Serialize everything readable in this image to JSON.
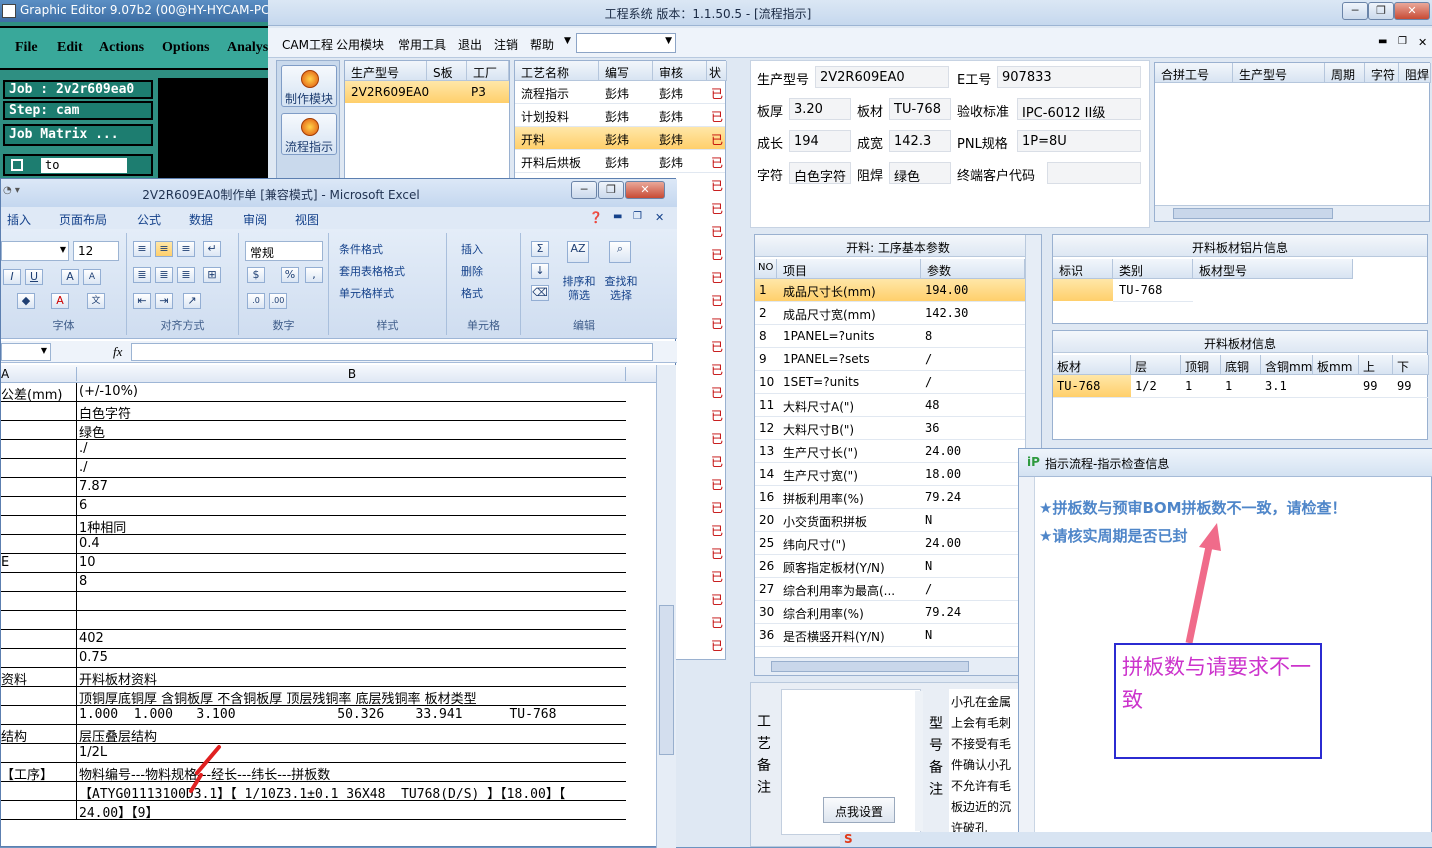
{
  "graphic_editor": {
    "title": "Graphic Editor 9.07b2 (00@HY-HYCAM-PC",
    "menu": [
      "File",
      "Edit",
      "Actions",
      "Options",
      "Analys"
    ],
    "job": "Job : 2v2r609ea0",
    "step": "Step: cam",
    "job_matrix": "Job Matrix ...",
    "to": "to"
  },
  "main": {
    "title": "工程系统   版本：1.1.50.5 - [流程指示]",
    "menu": [
      "CAM工程",
      "公用模块",
      "常用工具",
      "退出",
      "注销",
      "帮助"
    ],
    "side_buttons": [
      "制作模块",
      "流程指示"
    ],
    "model_grid": {
      "headers": [
        "生产型号",
        "S板",
        "工厂"
      ],
      "rows": [
        [
          "2V2R609EA0",
          "",
          "P3"
        ]
      ]
    },
    "process_grid": {
      "headers": [
        "工艺名称",
        "编写",
        "审核",
        "状"
      ],
      "rows": [
        [
          "流程指示",
          "彭炜",
          "彭炜",
          "已"
        ],
        [
          "计划投料",
          "彭炜",
          "彭炜",
          "已"
        ],
        [
          "开料",
          "彭炜",
          "彭炜",
          "已"
        ],
        [
          "开料后烘板",
          "彭炜",
          "彭炜",
          "已"
        ]
      ],
      "status_more": [
        "已",
        "已",
        "已",
        "已",
        "已",
        "已",
        "已",
        "已",
        "已",
        "已",
        "已",
        "已",
        "已",
        "已",
        "已",
        "已",
        "已",
        "已",
        "已",
        "已",
        "已"
      ]
    },
    "info": {
      "model_label": "生产型号",
      "model": "2V2R609EA0",
      "eno_label": "E工号",
      "eno": "907833",
      "thick_label": "板厚",
      "thick": "3.20",
      "mat_label": "板材",
      "mat": "TU-768",
      "std_label": "验收标准",
      "std": "IPC-6012 II级",
      "len_label": "成长",
      "len": "194",
      "wid_label": "成宽",
      "wid": "142.3",
      "pnl_label": "PNL规格",
      "pnl": "1P=8U",
      "char_label": "字符",
      "char": "白色字符",
      "mask_label": "阻焊",
      "mask": "绿色",
      "cust_label": "终端客户代码",
      "cust": ""
    },
    "merge_grid": {
      "headers": [
        "合拼工号",
        "生产型号",
        "周期",
        "字符",
        "阻焊"
      ]
    },
    "cut_params": {
      "title": "开料: 工序基本参数",
      "headers": [
        "NO",
        "项目",
        "参数"
      ],
      "rows": [
        [
          "1",
          "成品尺寸长(mm)",
          "194.00"
        ],
        [
          "2",
          "成品尺寸宽(mm)",
          "142.30"
        ],
        [
          "8",
          "1PANEL=?units",
          "8"
        ],
        [
          "9",
          "1PANEL=?sets",
          "/"
        ],
        [
          "10",
          "1SET=?units",
          "/"
        ],
        [
          "11",
          "大料尺寸A(\")",
          "48"
        ],
        [
          "12",
          "大料尺寸B(\")",
          "36"
        ],
        [
          "13",
          "生产尺寸长(\")",
          "24.00"
        ],
        [
          "14",
          "生产尺寸宽(\")",
          "18.00"
        ],
        [
          "16",
          "拼板利用率(%)",
          "79.24"
        ],
        [
          "20",
          "小交货面积拼板",
          "N"
        ],
        [
          "25",
          "纬向尺寸(\")",
          "24.00"
        ],
        [
          "26",
          "顾客指定板材(Y/N)",
          "N"
        ],
        [
          "27",
          "综合利用率为最高(...",
          "/"
        ],
        [
          "30",
          "综合利用率(%)",
          "79.24"
        ],
        [
          "36",
          "是否横竖开料(Y/N)",
          "N"
        ]
      ]
    },
    "al_sheet": {
      "title": "开料板材铝片信息",
      "headers": [
        "标识",
        "类别",
        "板材型号"
      ],
      "rows": [
        [
          "",
          "TU-768",
          ""
        ]
      ]
    },
    "sheet_info": {
      "title": "开料板材信息",
      "headers": [
        "板材",
        "层",
        "顶铜",
        "底铜",
        "含铜mm",
        "板mm",
        "上",
        "下"
      ],
      "rows": [
        [
          "TU-768",
          "1/2",
          "1",
          "1",
          "3.1",
          "",
          "99",
          "99"
        ]
      ]
    },
    "notes": {
      "process_label": "工艺备注",
      "model_label": "型号备注",
      "set_button": "点我设置",
      "model_notes": [
        "小孔在金属",
        "上会有毛刺",
        "不接受有毛",
        "件确认小孔",
        "不允许有毛",
        "板边近的沉",
        "许破孔"
      ]
    }
  },
  "excel": {
    "title": "2V2R609EA0制作单  [兼容模式] - Microsoft Excel",
    "tabs": [
      "插入",
      "页面布局",
      "公式",
      "数据",
      "审阅",
      "视图"
    ],
    "font_size": "12",
    "number_format": "常规",
    "groups": [
      "字体",
      "对齐方式",
      "数字",
      "样式",
      "单元格",
      "编辑"
    ],
    "style_buttons": [
      "条件格式",
      "套用表格格式",
      "单元格样式"
    ],
    "cell_buttons": [
      "插入",
      "删除",
      "格式"
    ],
    "edit_buttons": [
      "排序和筛选",
      "查找和选择"
    ],
    "fx": "fx",
    "col_a": "A",
    "col_b": "B",
    "rows": [
      [
        "公差(mm)",
        "(+/-10%)"
      ],
      [
        "",
        "白色字符"
      ],
      [
        "",
        "绿色"
      ],
      [
        "",
        "./"
      ],
      [
        "",
        "./"
      ],
      [
        "",
        "7.87"
      ],
      [
        "",
        "6"
      ],
      [
        "",
        "1种相同"
      ],
      [
        "",
        "0.4"
      ],
      [
        "E",
        "10"
      ],
      [
        "",
        "8"
      ],
      [
        "",
        ""
      ],
      [
        "",
        ""
      ],
      [
        "",
        "402"
      ],
      [
        "",
        "0.75"
      ],
      [
        "资料",
        "开料板材资料"
      ],
      [
        "",
        "顶铜厚底铜厚 含铜板厚 不含铜板厚 顶层残铜率 底层残铜率 板材类型"
      ],
      [
        "",
        "1.000  1.000   3.100             50.326    33.941      TU-768"
      ],
      [
        "结构",
        "层压叠层结构"
      ],
      [
        "",
        "1/2L"
      ],
      [
        "【工序】",
        "物料编号---物料规格---经长---纬长---拼板数"
      ],
      [
        "",
        "【ATYG01113100D3.1】【 1/10Z3.1±0.1 36X48  TU768(D/S) 】【18.00】【"
      ],
      [
        "",
        "24.00】【9】"
      ]
    ]
  },
  "dialog": {
    "title": "指示流程-指示检查信息",
    "messages": [
      "★拼板数与预审BOM拼板数不一致，请检查！",
      "★请核实周期是否已封"
    ]
  },
  "annotation": "拼板数与请要求不一致",
  "colors": {
    "accent": "#4f86c9",
    "annotation_border": "#2b2bd1",
    "annotation_text": "#cc33cc",
    "arrow": "#f06b8a"
  }
}
